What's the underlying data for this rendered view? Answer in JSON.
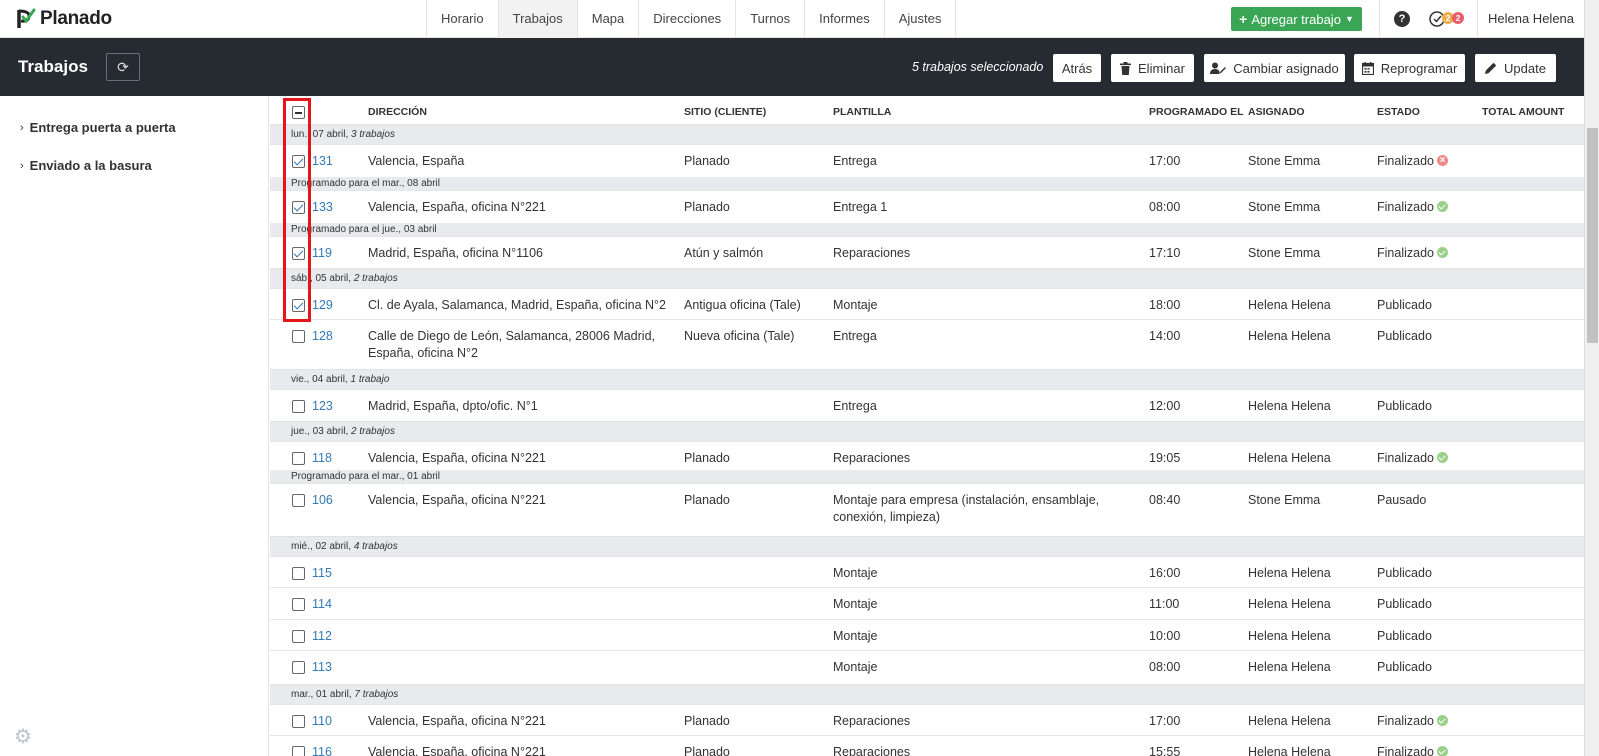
{
  "app": {
    "brand": "Planado"
  },
  "nav": {
    "items": [
      "Horario",
      "Trabajos",
      "Mapa",
      "Direcciones",
      "Turnos",
      "Informes",
      "Ajustes"
    ],
    "active": "Trabajos"
  },
  "topbar": {
    "add_job_label": "Agregar trabajo",
    "help_label": "?",
    "notif_count_a": "2",
    "notif_count_b": "2",
    "user_name": "Helena Helena"
  },
  "subheader": {
    "title": "Trabajos",
    "selected_text": "5 trabajos seleccionado",
    "back_label": "Atrás",
    "delete_label": "Eliminar",
    "change_assignee_label": "Cambiar asignado",
    "reschedule_label": "Reprogramar",
    "update_label": "Update"
  },
  "sidebar": {
    "items": [
      "Entrega puerta a puerta",
      "Enviado a la basura"
    ]
  },
  "table": {
    "headers": {
      "address": "DIRECCIÓN",
      "site": "SITIO (CLIENTE)",
      "template": "PLANTILLA",
      "scheduled": "PROGRAMADO EL",
      "assigned": "ASIGNADO",
      "status": "ESTADO",
      "total": "TOTAL AMOUNT"
    },
    "groups": [
      {
        "date": "lun., 07 abril,",
        "count": "3 trabajos"
      },
      {
        "date": "sáb., 05 abril,",
        "count": "2 trabajos"
      },
      {
        "date": "vie., 04 abril,",
        "count": "1 trabajo"
      },
      {
        "date": "jue., 03 abril,",
        "count": "2 trabajos"
      },
      {
        "date": "mié., 02 abril,",
        "count": "4 trabajos"
      },
      {
        "date": "mar., 01 abril,",
        "count": "7 trabajos"
      }
    ],
    "scheduled_notes": [
      "Programado para el mar., 08 abril",
      "Programado para el jue., 03 abril",
      "Programado para el mar., 01 abril"
    ],
    "rows": [
      {
        "id": "131",
        "address": "Valencia, España",
        "site": "Planado",
        "template": "Entrega",
        "time": "17:00",
        "assigned": "Stone Emma",
        "status": "Finalizado",
        "status_icon": "error",
        "checked": true
      },
      {
        "id": "133",
        "address": "Valencia, España, oficina N°221",
        "site": "Planado",
        "template": "Entrega 1",
        "time": "08:00",
        "assigned": "Stone Emma",
        "status": "Finalizado",
        "status_icon": "ok",
        "checked": true
      },
      {
        "id": "119",
        "address": "Madrid, España, oficina N°1106",
        "site": "Atún y salmón",
        "template": "Reparaciones",
        "time": "17:10",
        "assigned": "Stone Emma",
        "status": "Finalizado",
        "status_icon": "ok",
        "checked": true
      },
      {
        "id": "129",
        "address": "Cl. de Ayala, Salamanca, Madrid, España, oficina N°2",
        "site": "Antigua oficina (Tale)",
        "template": "Montaje",
        "time": "18:00",
        "assigned": "Helena Helena",
        "status": "Publicado",
        "status_icon": "",
        "checked": true
      },
      {
        "id": "128",
        "address": "Calle de Diego de León, Salamanca, 28006 Madrid, España, oficina N°2",
        "site": "Nueva oficina (Tale)",
        "template": "Entrega",
        "time": "14:00",
        "assigned": "Helena Helena",
        "status": "Publicado",
        "status_icon": "",
        "checked": false
      },
      {
        "id": "123",
        "address": "Madrid, España, dpto/ofic. N°1",
        "site": "",
        "template": "Entrega",
        "time": "12:00",
        "assigned": "Helena Helena",
        "status": "Publicado",
        "status_icon": "",
        "checked": false
      },
      {
        "id": "118",
        "address": "Valencia, España, oficina N°221",
        "site": "Planado",
        "template": "Reparaciones",
        "time": "19:05",
        "assigned": "Helena Helena",
        "status": "Finalizado",
        "status_icon": "ok",
        "checked": false
      },
      {
        "id": "106",
        "address": "Valencia, España, oficina N°221",
        "site": "Planado",
        "template": "Montaje para empresa (instalación, ensamblaje, conexión, limpieza)",
        "time": "08:40",
        "assigned": "Stone Emma",
        "status": "Pausado",
        "status_icon": "",
        "checked": false
      },
      {
        "id": "115",
        "address": "",
        "site": "",
        "template": "Montaje",
        "time": "16:00",
        "assigned": "Helena Helena",
        "status": "Publicado",
        "status_icon": "",
        "checked": false
      },
      {
        "id": "114",
        "address": "",
        "site": "",
        "template": "Montaje",
        "time": "11:00",
        "assigned": "Helena Helena",
        "status": "Publicado",
        "status_icon": "",
        "checked": false
      },
      {
        "id": "112",
        "address": "",
        "site": "",
        "template": "Montaje",
        "time": "10:00",
        "assigned": "Helena Helena",
        "status": "Publicado",
        "status_icon": "",
        "checked": false
      },
      {
        "id": "113",
        "address": "",
        "site": "",
        "template": "Montaje",
        "time": "08:00",
        "assigned": "Helena Helena",
        "status": "Publicado",
        "status_icon": "",
        "checked": false
      },
      {
        "id": "110",
        "address": "Valencia, España, oficina N°221",
        "site": "Planado",
        "template": "Reparaciones",
        "time": "17:00",
        "assigned": "Helena Helena",
        "status": "Finalizado",
        "status_icon": "ok",
        "checked": false
      },
      {
        "id": "116",
        "address": "Valencia, España, oficina N°221",
        "site": "Planado",
        "template": "Reparaciones",
        "time": "15:55",
        "assigned": "Helena Helena",
        "status": "Finalizado",
        "status_icon": "ok",
        "checked": false
      }
    ]
  },
  "colors": {
    "accent": "#337ab7",
    "success": "#3aa655",
    "dark_header": "#262a31",
    "highlight": "#e3161b"
  }
}
